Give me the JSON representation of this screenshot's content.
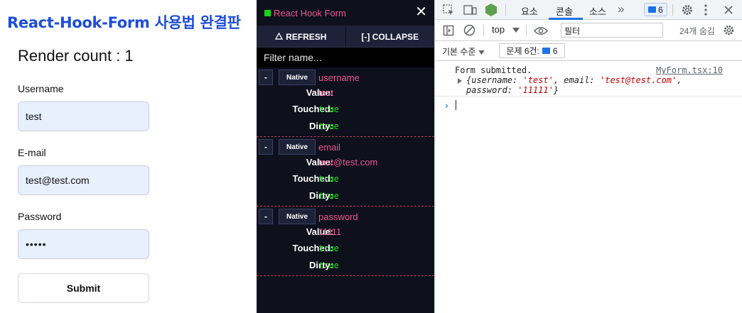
{
  "app": {
    "title": "React-Hook-Form 사용법 완결판",
    "render_count": "Render count : 1",
    "fields": [
      {
        "label": "Username",
        "value": "test"
      },
      {
        "label": "E-mail",
        "value": "test@test.com"
      },
      {
        "label": "Password",
        "value": "•••••"
      }
    ],
    "submit_label": "Submit"
  },
  "rhf_devtools": {
    "title": "React Hook Form",
    "close": "✕",
    "refresh_label": "REFRESH",
    "collapse_label": "[-] COLLAPSE",
    "filter_placeholder": "Filter name...",
    "labels": {
      "value": "Value:",
      "touched": "Touched:",
      "dirty": "Dirty:"
    },
    "minus": "-",
    "native": "Native",
    "fields": [
      {
        "name": "username",
        "value": "test",
        "touched": "true",
        "dirty": "true"
      },
      {
        "name": "email",
        "value": "test@test.com",
        "touched": "true",
        "dirty": "true"
      },
      {
        "name": "password",
        "value": "11111",
        "touched": "true",
        "dirty": "true"
      }
    ],
    "colors": {
      "accent": "#ec5990",
      "true_color": "#16e116",
      "bg": "#0e101c"
    }
  },
  "browser_devtools": {
    "tabs": [
      "요소",
      "콘솔",
      "소스"
    ],
    "active_tab": "콘솔",
    "more_tabs": "»",
    "issues_badge": "6",
    "context": "top",
    "filter_placeholder": "필터",
    "hidden_count": "24개 숨김",
    "default_levels": "기본 수준",
    "issues_label": "문제 6건:",
    "issues_count": "6",
    "console": {
      "message": "Form submitted.",
      "source": "MyForm.tsx:10",
      "object_text": {
        "open": "{username: ",
        "username": "'test'",
        "email_key": ", email: ",
        "email": "'test@test.com'",
        "password_key": ", password: ",
        "password": "'11111'",
        "close": "}"
      }
    },
    "prompt": "›"
  }
}
